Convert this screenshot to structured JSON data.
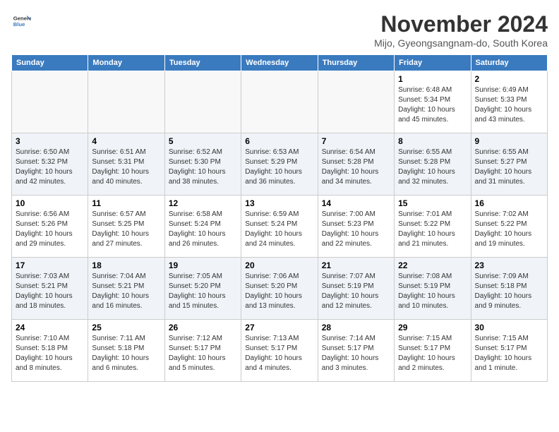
{
  "header": {
    "logo_line1": "General",
    "logo_line2": "Blue",
    "month_title": "November 2024",
    "location": "Mijo, Gyeongsangnam-do, South Korea"
  },
  "days_of_week": [
    "Sunday",
    "Monday",
    "Tuesday",
    "Wednesday",
    "Thursday",
    "Friday",
    "Saturday"
  ],
  "weeks": [
    [
      {
        "day": "",
        "info": ""
      },
      {
        "day": "",
        "info": ""
      },
      {
        "day": "",
        "info": ""
      },
      {
        "day": "",
        "info": ""
      },
      {
        "day": "",
        "info": ""
      },
      {
        "day": "1",
        "info": "Sunrise: 6:48 AM\nSunset: 5:34 PM\nDaylight: 10 hours and 45 minutes."
      },
      {
        "day": "2",
        "info": "Sunrise: 6:49 AM\nSunset: 5:33 PM\nDaylight: 10 hours and 43 minutes."
      }
    ],
    [
      {
        "day": "3",
        "info": "Sunrise: 6:50 AM\nSunset: 5:32 PM\nDaylight: 10 hours and 42 minutes."
      },
      {
        "day": "4",
        "info": "Sunrise: 6:51 AM\nSunset: 5:31 PM\nDaylight: 10 hours and 40 minutes."
      },
      {
        "day": "5",
        "info": "Sunrise: 6:52 AM\nSunset: 5:30 PM\nDaylight: 10 hours and 38 minutes."
      },
      {
        "day": "6",
        "info": "Sunrise: 6:53 AM\nSunset: 5:29 PM\nDaylight: 10 hours and 36 minutes."
      },
      {
        "day": "7",
        "info": "Sunrise: 6:54 AM\nSunset: 5:28 PM\nDaylight: 10 hours and 34 minutes."
      },
      {
        "day": "8",
        "info": "Sunrise: 6:55 AM\nSunset: 5:28 PM\nDaylight: 10 hours and 32 minutes."
      },
      {
        "day": "9",
        "info": "Sunrise: 6:55 AM\nSunset: 5:27 PM\nDaylight: 10 hours and 31 minutes."
      }
    ],
    [
      {
        "day": "10",
        "info": "Sunrise: 6:56 AM\nSunset: 5:26 PM\nDaylight: 10 hours and 29 minutes."
      },
      {
        "day": "11",
        "info": "Sunrise: 6:57 AM\nSunset: 5:25 PM\nDaylight: 10 hours and 27 minutes."
      },
      {
        "day": "12",
        "info": "Sunrise: 6:58 AM\nSunset: 5:24 PM\nDaylight: 10 hours and 26 minutes."
      },
      {
        "day": "13",
        "info": "Sunrise: 6:59 AM\nSunset: 5:24 PM\nDaylight: 10 hours and 24 minutes."
      },
      {
        "day": "14",
        "info": "Sunrise: 7:00 AM\nSunset: 5:23 PM\nDaylight: 10 hours and 22 minutes."
      },
      {
        "day": "15",
        "info": "Sunrise: 7:01 AM\nSunset: 5:22 PM\nDaylight: 10 hours and 21 minutes."
      },
      {
        "day": "16",
        "info": "Sunrise: 7:02 AM\nSunset: 5:22 PM\nDaylight: 10 hours and 19 minutes."
      }
    ],
    [
      {
        "day": "17",
        "info": "Sunrise: 7:03 AM\nSunset: 5:21 PM\nDaylight: 10 hours and 18 minutes."
      },
      {
        "day": "18",
        "info": "Sunrise: 7:04 AM\nSunset: 5:21 PM\nDaylight: 10 hours and 16 minutes."
      },
      {
        "day": "19",
        "info": "Sunrise: 7:05 AM\nSunset: 5:20 PM\nDaylight: 10 hours and 15 minutes."
      },
      {
        "day": "20",
        "info": "Sunrise: 7:06 AM\nSunset: 5:20 PM\nDaylight: 10 hours and 13 minutes."
      },
      {
        "day": "21",
        "info": "Sunrise: 7:07 AM\nSunset: 5:19 PM\nDaylight: 10 hours and 12 minutes."
      },
      {
        "day": "22",
        "info": "Sunrise: 7:08 AM\nSunset: 5:19 PM\nDaylight: 10 hours and 10 minutes."
      },
      {
        "day": "23",
        "info": "Sunrise: 7:09 AM\nSunset: 5:18 PM\nDaylight: 10 hours and 9 minutes."
      }
    ],
    [
      {
        "day": "24",
        "info": "Sunrise: 7:10 AM\nSunset: 5:18 PM\nDaylight: 10 hours and 8 minutes."
      },
      {
        "day": "25",
        "info": "Sunrise: 7:11 AM\nSunset: 5:18 PM\nDaylight: 10 hours and 6 minutes."
      },
      {
        "day": "26",
        "info": "Sunrise: 7:12 AM\nSunset: 5:17 PM\nDaylight: 10 hours and 5 minutes."
      },
      {
        "day": "27",
        "info": "Sunrise: 7:13 AM\nSunset: 5:17 PM\nDaylight: 10 hours and 4 minutes."
      },
      {
        "day": "28",
        "info": "Sunrise: 7:14 AM\nSunset: 5:17 PM\nDaylight: 10 hours and 3 minutes."
      },
      {
        "day": "29",
        "info": "Sunrise: 7:15 AM\nSunset: 5:17 PM\nDaylight: 10 hours and 2 minutes."
      },
      {
        "day": "30",
        "info": "Sunrise: 7:15 AM\nSunset: 5:17 PM\nDaylight: 10 hours and 1 minute."
      }
    ]
  ]
}
